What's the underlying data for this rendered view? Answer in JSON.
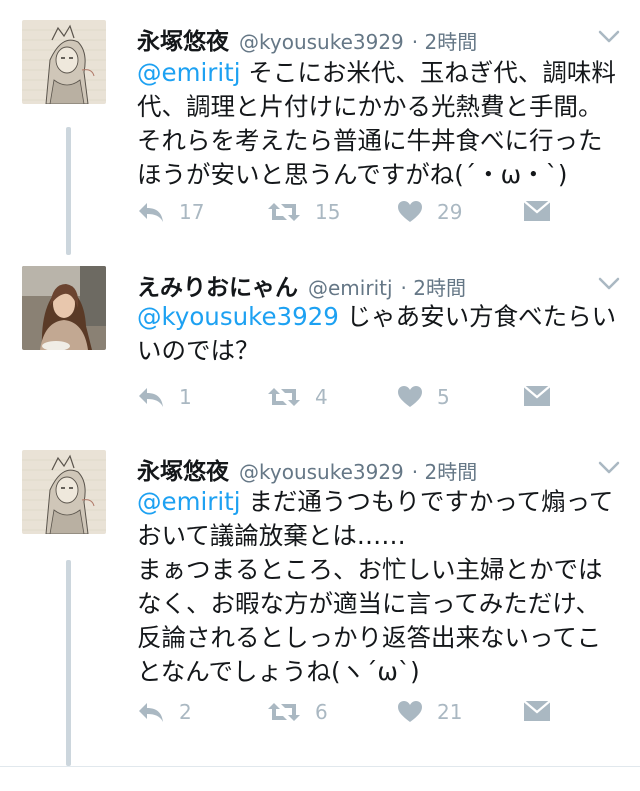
{
  "colors": {
    "link": "#1da1f2",
    "meta": "#657786",
    "action": "#aab8c2",
    "thread": "#ccd6dd"
  },
  "tweets": [
    {
      "name": "永塚悠夜",
      "handle": "@kyousuke3929",
      "time": "· 2時間",
      "mention": "@emiritj",
      "lines": [
        "そこにお米代、玉ねぎ代、調味料",
        "代、調理と片付けにかかる光熱費と手間。",
        "それらを考えたら普通に牛丼食べに行った",
        "ほうが安いと思うんですがね(´・ω・`)"
      ],
      "avatar_icon": "anime-drawing-avatar",
      "replies": "17",
      "retweets": "15",
      "likes": "29"
    },
    {
      "name": "えみりおにゃん",
      "handle": "@emiritj",
      "time": "· 2時間",
      "mention": "@kyousuke3929",
      "lines": [
        "じゃあ安い方食べたらい",
        "いのでは？"
      ],
      "avatar_icon": "woman-photo-avatar",
      "replies": "1",
      "retweets": "4",
      "likes": "5"
    },
    {
      "name": "永塚悠夜",
      "handle": "@kyousuke3929",
      "time": "· 2時間",
      "mention": "@emiritj",
      "lines": [
        "まだ通うつもりですかって煽って",
        "おいて議論放棄とは……",
        "まぁつまるところ、お忙しい主婦とかでは",
        "なく、お暇な方が適当に言ってみただけ、",
        "反論されるとしっかり返答出来ないってこ",
        "となんでしょうね(ヽ´ω`)"
      ],
      "avatar_icon": "anime-drawing-avatar",
      "replies": "2",
      "retweets": "6",
      "likes": "21"
    }
  ]
}
